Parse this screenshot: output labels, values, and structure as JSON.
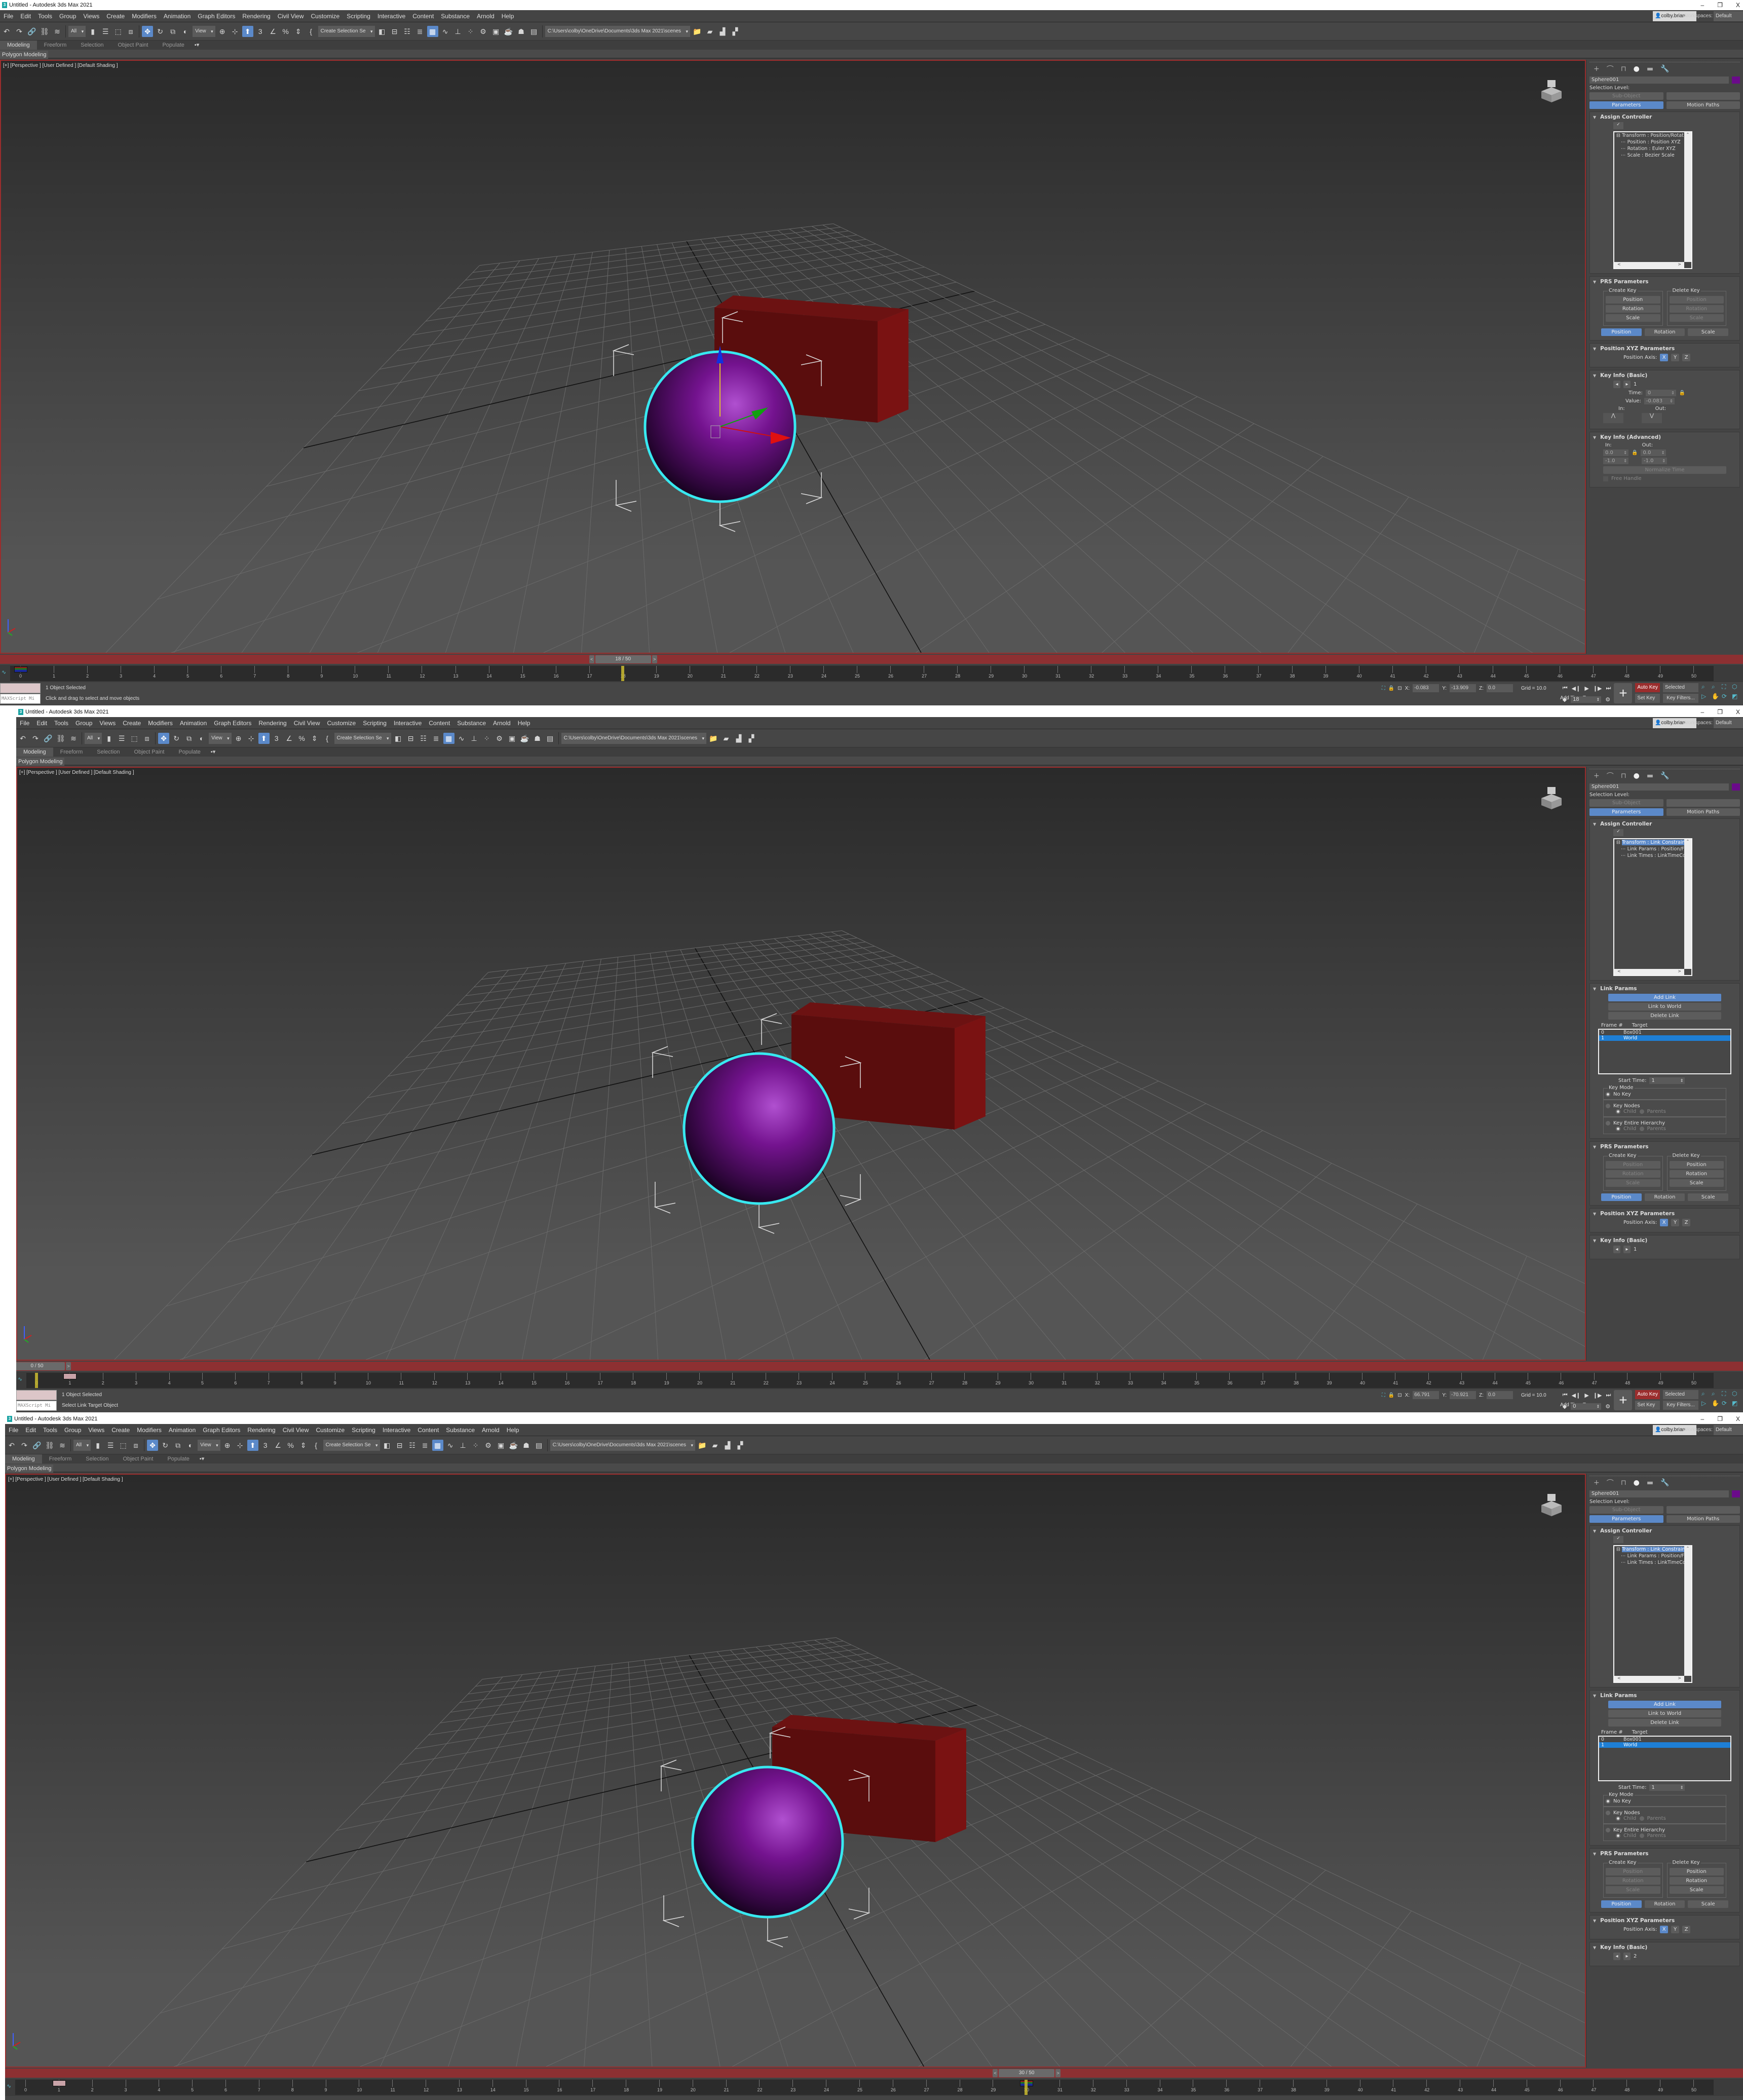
{
  "app": {
    "title": "Untitled - Autodesk 3ds Max 2021",
    "window_controls": [
      "–",
      "❐",
      "X"
    ],
    "menu": [
      "File",
      "Edit",
      "Tools",
      "Group",
      "Views",
      "Create",
      "Modifiers",
      "Animation",
      "Graph Editors",
      "Rendering",
      "Civil View",
      "Customize",
      "Scripting",
      "Interactive",
      "Content",
      "Substance",
      "Arnold",
      "Help"
    ],
    "user": "colby.brian",
    "workspaces_label": "Workspaces:",
    "workspace": "Default",
    "toolbar": {
      "filter": "All",
      "ref_coord": "View",
      "selection_set": "Create Selection Se",
      "project_path": "C:\\Users\\colby\\OneDrive\\Documents\\3ds Max 2021\\scenes",
      "icons_a": [
        "undo-icon",
        "redo-icon",
        "link-icon",
        "unlink-icon",
        "bind-space-warp-icon"
      ],
      "icons_b": [
        "select-object-icon",
        "select-by-name-icon",
        "rectangle-selection-icon",
        "window-crossing-icon"
      ],
      "icons_c": [
        "move-icon",
        "rotate-icon",
        "scale-icon",
        "placement-icon"
      ],
      "icons_d": [
        "pivot-icon",
        "keyboard-shortcut-icon",
        "use-pivot-icon",
        "snap-3d-icon",
        "angle-snap-icon",
        "percent-snap-icon",
        "spinner-snap-icon",
        "edit-named-selection-icon"
      ],
      "icons_e": [
        "mirror-icon",
        "align-icon",
        "scene-explorer-icon",
        "layer-explorer-icon",
        "toggle-ribbon-icon",
        "curve-editor-icon",
        "schematic-view-icon",
        "material-editor-icon",
        "render-setup-icon",
        "render-frame-icon",
        "render-icon",
        "render-production-icon",
        "render-iterative-icon"
      ],
      "icons_f": [
        "open-project-icon",
        "project-folder-icon",
        "set-project-icon",
        "project-manager-icon"
      ]
    },
    "ribbon_tabs": [
      "Modeling",
      "Freeform",
      "Selection",
      "Object Paint",
      "Populate"
    ],
    "ribbon_extra": "▪▾",
    "ribbon_panel": "Polygon Modeling",
    "viewport_label": "[+] [Perspective ] [User Defined ] [Default Shading ]",
    "maxscript": "MAXScript Mi",
    "grid": "Grid = 10.0",
    "add_time_tag": "Add Time Tag",
    "auto_key": "Auto Key",
    "set_key": "Set Key",
    "key_mode": "Selected",
    "key_filters": "Key Filters...",
    "coord_labels": [
      "X:",
      "Y:",
      "Z:"
    ],
    "total_frames": 50,
    "command_panel": {
      "tabs": [
        "create-icon",
        "modify-icon",
        "hierarchy-icon",
        "motion-icon",
        "display-icon",
        "utilities-icon"
      ],
      "selection_level": "Selection Level:",
      "sub_object": "Sub-Object",
      "parameters": "Parameters",
      "motion_paths": "Motion Paths",
      "assign_controller": "Assign Controller",
      "prs": {
        "title": "PRS Parameters",
        "create_key": "Create Key",
        "delete_key": "Delete Key",
        "buttons": [
          "Position",
          "Rotation",
          "Scale"
        ]
      },
      "pos_xyz": {
        "title": "Position XYZ Parameters",
        "axis_label": "Position Axis:",
        "axes": [
          "X",
          "Y",
          "Z"
        ]
      },
      "key_basic_title": "Key Info (Basic)",
      "key_advanced_title": "Key Info (Advanced)",
      "link": {
        "title": "Link Params",
        "add": "Add Link",
        "world": "Link to World",
        "delete": "Delete Link",
        "frame_col": "Frame #",
        "target_col": "Target",
        "start_time_label": "Start Time:",
        "key_mode": "Key Mode",
        "no_key": "No Key",
        "key_nodes": "Key Nodes",
        "key_hier": "Key Entire Hierarchy",
        "child": "Child",
        "parents": "Parents"
      }
    },
    "colors": {
      "accent": "#5b89c9",
      "viewport_border": "#9b2d2d",
      "sphere": "#7a1a9a",
      "box": "#7a1010",
      "selection": "#38e8f0",
      "auto_key": "#9b2d2d"
    }
  },
  "windows": [
    {
      "current_frame": 18,
      "slider_label": "18 / 50",
      "keys": [
        {
          "frame": 0,
          "style": "prs"
        }
      ],
      "coords": [
        "-0.083",
        "-13.909",
        "0.0"
      ],
      "frame_value": "18",
      "status_line1": "1 Object Selected",
      "status_line2": "Click and drag to select and move objects",
      "show_gizmo": true,
      "command_panel": {
        "object_name": "Sphere001",
        "controller_tree": [
          "Transform : Position/Rotat",
          "Position : Position XYZ",
          "Rotation : Euler XYZ",
          "Scale : Bezier Scale"
        ],
        "controller_selected": -1,
        "has_link_params": false,
        "prs_create_enabled": true,
        "prs_delete_enabled": false,
        "key_number": "1",
        "key_time_label": "Time:",
        "key_time": "0",
        "key_value_label": "Value:",
        "key_value": "-0.083",
        "in_label": "In:",
        "out_label": "Out:",
        "advanced": {
          "in_label": "In:",
          "out_label": "Out:",
          "in1": "0.0",
          "out1": "0.0",
          "in2": "-1.0",
          "out2": "-1.0",
          "normalize": "Normalize Time",
          "free_handle": "Free Handle"
        }
      }
    },
    {
      "current_frame": 0,
      "slider_label": "0 / 50",
      "keys": [
        {
          "frame": 1,
          "style": "pink"
        }
      ],
      "coords": [
        "66.791",
        "-70.921",
        "0.0"
      ],
      "frame_value": "0",
      "status_line1": "1 Object Selected",
      "status_line2": "Select Link Target Object",
      "show_gizmo": false,
      "command_panel": {
        "object_name": "Sphere001",
        "controller_tree": [
          "Transform : Link Constrain",
          "Link Params : Position/F",
          "Link Times : LinkTimeCo"
        ],
        "controller_selected": 0,
        "has_link_params": true,
        "link_rows": [
          {
            "frame": "0",
            "target": "Box001"
          },
          {
            "frame": "1",
            "target": "World"
          }
        ],
        "link_selected": 1,
        "start_time": "1",
        "prs_create_enabled": false,
        "prs_delete_enabled": true,
        "key_number": "1"
      }
    },
    {
      "current_frame": 30,
      "slider_label": "30 / 50",
      "keys": [
        {
          "frame": 1,
          "style": "pink"
        },
        {
          "frame": 30,
          "style": "prs"
        }
      ],
      "show_gizmo": false,
      "command_panel": {
        "object_name": "Sphere001",
        "controller_tree": [
          "Transform : Link Constrain",
          "Link Params : Position/F",
          "Link Times : LinkTimeCo"
        ],
        "controller_selected": 0,
        "has_link_params": true,
        "link_rows": [
          {
            "frame": "0",
            "target": "Box001"
          },
          {
            "frame": "1",
            "target": "World"
          }
        ],
        "link_selected": 1,
        "start_time": "1",
        "prs_create_enabled": false,
        "prs_delete_enabled": true,
        "key_number": "2"
      }
    }
  ]
}
